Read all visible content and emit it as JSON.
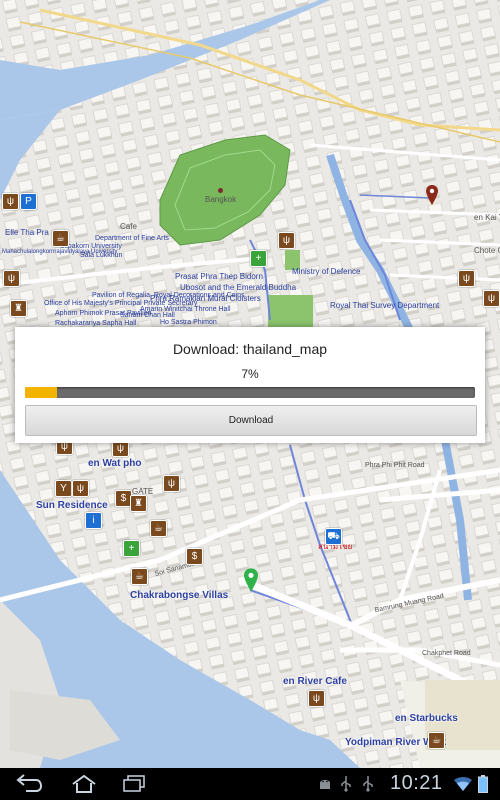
{
  "dialog": {
    "title": "Download: thailand_map",
    "percent_text": "7%",
    "progress_fraction": 0.07,
    "button_label": "Download"
  },
  "map": {
    "city_label": "Bangkok",
    "labels": {
      "ministry_of_defence": "Ministry of Defence",
      "royal_thai_survey": "Royal Thai Survey Department",
      "en_wat_pho": "en Wat pho",
      "chakrabongse": "Chakrabongse Villas",
      "sun_residence": "Sun Residence",
      "en_river_cafe": "en River Cafe",
      "en_starbucks": "en Starbucks",
      "yodpiman": "Yodpiman River Walk",
      "cafe": "Cafe",
      "gate": "GATE",
      "soi_sanamchai": "Soi Sanamchai",
      "phra_phi_phit": "Phra Phi Phit Road",
      "bamrung_muang": "Bamrung Muang Road",
      "chakphet": "Chakphet Road",
      "chote": "Chote Cha",
      "en_kai_ya": "en Kai Ya",
      "thai_sign": "สนามไชย"
    },
    "palace_labels": [
      "Prasat Phra Thep Bidorn",
      "Ubosot and the Emerald Buddha",
      "Phra Ramakian Mural Cloisters",
      "Pavilion of Regalia, Royal Decorations and Coins",
      "Office of His Majesty's Principal Private Secretary",
      "Amarin Winitchai Throne Hall",
      "Aphorn Phimok Prasat Pavilion",
      "Sanam Chan Hall",
      "Rachakaranya Sapha Hall",
      "Ho Sastra Phimon"
    ],
    "left_labels": [
      "Elle Tha Pra",
      "Department of Fine Arts",
      "Silpakorn University",
      "Sala Lukkhun",
      "Mahachulalongkornrajavidyalaya University"
    ]
  },
  "status_bar": {
    "time": "10:21"
  },
  "nav": {
    "back_icon": "back-icon",
    "home_icon": "home-icon",
    "recents_icon": "recents-icon"
  },
  "colors": {
    "progress_fill": "#f3b400",
    "progress_track": "#6b6b6b",
    "water": "#aac7e9",
    "park": "#79b85d",
    "route": "#6e86d9"
  }
}
